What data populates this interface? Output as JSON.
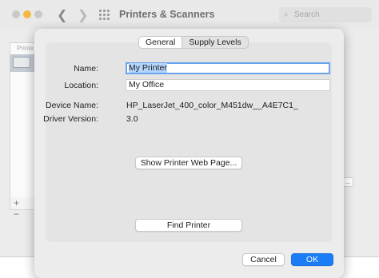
{
  "window": {
    "title": "Printers & Scanners",
    "search_placeholder": "Search",
    "list_header": "Printe",
    "add_symbol": "+",
    "remove_symbol": "−",
    "side_button": "..."
  },
  "sheet": {
    "tabs": [
      {
        "label": "General",
        "active": true
      },
      {
        "label": "Supply Levels",
        "active": false
      }
    ],
    "name_label": "Name:",
    "name_value": "My Printer",
    "location_label": "Location:",
    "location_value": "My Office",
    "device_name_label": "Device Name:",
    "device_name_value": "HP_LaserJet_400_color_M451dw__A4E7C1_",
    "driver_version_label": "Driver Version:",
    "driver_version_value": "3.0",
    "show_web_page_button": "Show Printer Web Page...",
    "find_printer_button": "Find Printer",
    "cancel_button": "Cancel",
    "ok_button": "OK"
  },
  "colors": {
    "accent": "#1a7df6",
    "selection": "#b3d4fc",
    "focus_ring": "#6aa4ef"
  }
}
